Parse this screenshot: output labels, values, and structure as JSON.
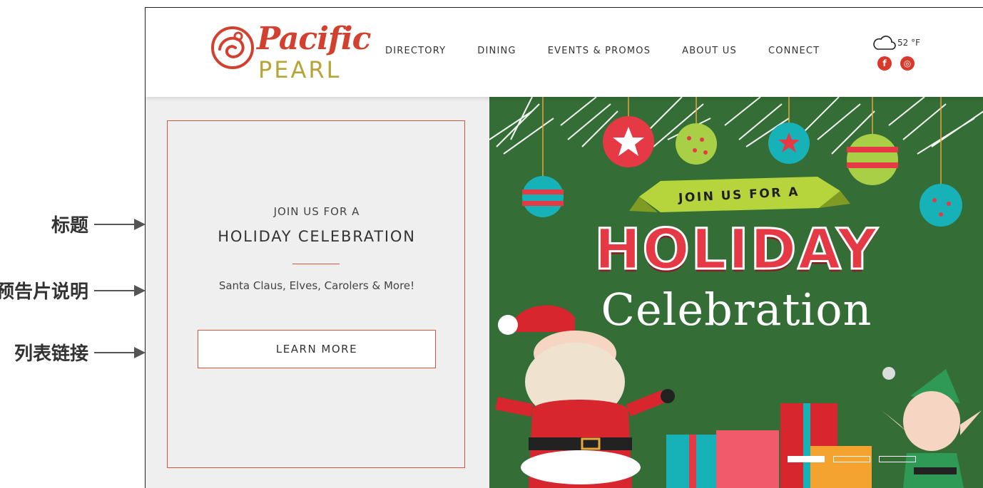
{
  "annotations": [
    {
      "label": "标题"
    },
    {
      "label": "预告片说明"
    },
    {
      "label": "列表链接"
    }
  ],
  "header": {
    "logo_top": "Pacific",
    "logo_bottom": "PEARL",
    "nav": [
      "DIRECTORY",
      "DINING",
      "EVENTS & PROMOS",
      "ABOUT US",
      "CONNECT"
    ],
    "weather": "52 °F",
    "socials": [
      {
        "icon": "facebook-icon",
        "glyph": "f"
      },
      {
        "icon": "instagram-icon",
        "glyph": "◎"
      }
    ]
  },
  "promo": {
    "kicker": "JOIN US FOR A",
    "title": "HOLIDAY CELEBRATION",
    "subtitle": "Santa Claus, Elves, Carolers & More!",
    "button": "LEARN MORE"
  },
  "hero": {
    "join": "JOIN US FOR A",
    "holiday": "HOLIDAY",
    "celebration": "Celebration",
    "slides": 3,
    "active_slide": 1
  },
  "colors": {
    "accent": "#d7553f",
    "brand_red": "#d2412f",
    "brand_gold": "#b7a437",
    "hero_green": "#346d35",
    "ornament_red": "#e63946",
    "ornament_teal": "#17b2b8",
    "ornament_lime": "#a8cf45"
  }
}
